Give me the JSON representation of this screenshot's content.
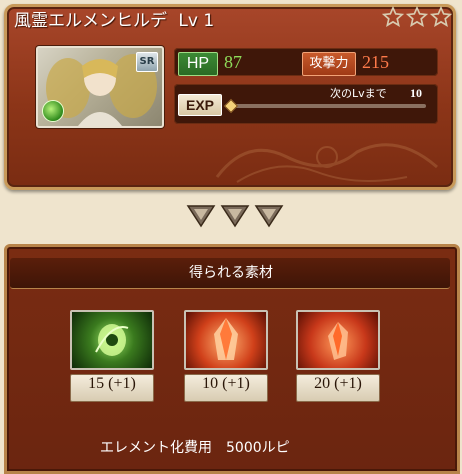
{
  "character": {
    "name": "風霊エルメンヒルデ",
    "level_label": "Lv 1",
    "rarity_badge": "SR",
    "element_icon": "wind-element-icon",
    "stars": 3
  },
  "stats": {
    "hp_label": "HP",
    "hp_value": "87",
    "atk_label": "攻撃力",
    "atk_value": "215",
    "exp_label": "EXP",
    "next_level_label": "次のLvまで",
    "next_level_value": "10",
    "exp_progress": 0
  },
  "materials": {
    "title": "得られる素材",
    "items": [
      {
        "icon": "wind-element-crystal-icon",
        "count": "15",
        "bonus": "(+1)"
      },
      {
        "icon": "fire-crystal-icon",
        "count": "10",
        "bonus": "(+1)"
      },
      {
        "icon": "fire-quartz-icon",
        "count": "20",
        "bonus": "(+1)"
      }
    ]
  },
  "cost": {
    "label": "エレメント化費用",
    "value": "5000ルピ"
  },
  "colors": {
    "card_bg": "#8c3518",
    "hp_green": "#8fdc5a",
    "atk_orange": "#ff7a4a",
    "panel_border": "#b8844a"
  }
}
